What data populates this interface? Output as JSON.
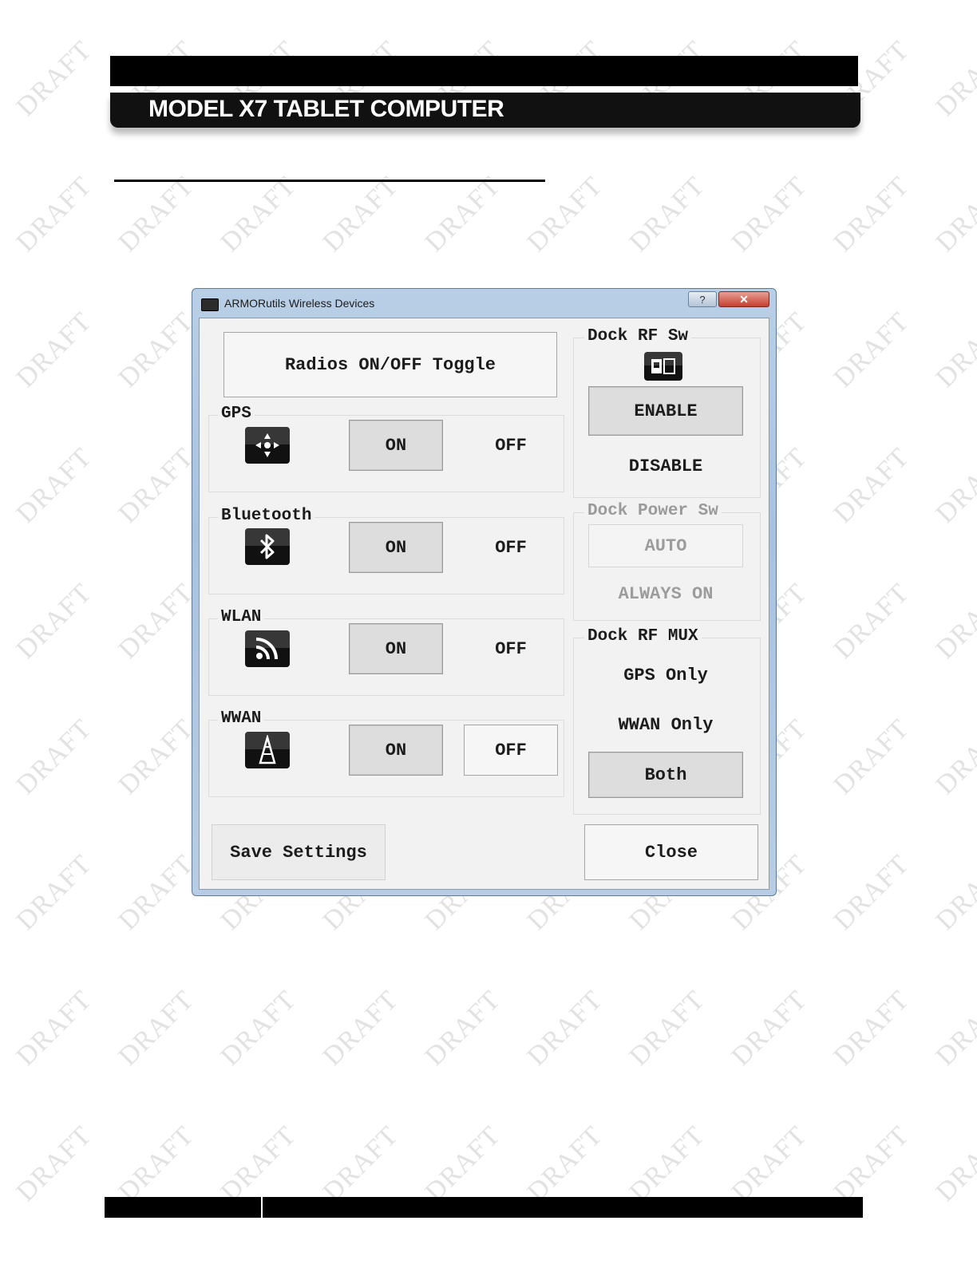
{
  "header": {
    "title": "MODEL X7 TABLET COMPUTER"
  },
  "watermark": "DRAFT",
  "window": {
    "title": "ARMORutils Wireless Devices",
    "help_label": "?",
    "close_label": "✕"
  },
  "radios_toggle_label": "Radios ON/OFF Toggle",
  "devices": [
    {
      "name": "GPS",
      "icon": "gps-crosshair-icon",
      "on_label": "ON",
      "off_label": "OFF",
      "selected": "ON"
    },
    {
      "name": "Bluetooth",
      "icon": "bluetooth-icon",
      "on_label": "ON",
      "off_label": "OFF",
      "selected": "ON"
    },
    {
      "name": "WLAN",
      "icon": "wifi-icon",
      "on_label": "ON",
      "off_label": "OFF",
      "selected": "ON"
    },
    {
      "name": "WWAN",
      "icon": "antenna-tower-icon",
      "on_label": "ON",
      "off_label": "OFF",
      "selected": "ON"
    }
  ],
  "dock_rf_sw": {
    "label": "Dock RF Sw",
    "icon": "dock-switch-icon",
    "enable_label": "ENABLE",
    "disable_label": "DISABLE",
    "selected": "ENABLE"
  },
  "dock_power_sw": {
    "label": "Dock Power Sw",
    "auto_label": "AUTO",
    "always_on_label": "ALWAYS ON",
    "enabled": false
  },
  "dock_rf_mux": {
    "label": "Dock RF MUX",
    "options": [
      "GPS Only",
      "WWAN Only",
      "Both"
    ],
    "selected": "Both"
  },
  "save_label": "Save Settings",
  "close_label": "Close",
  "colors": {
    "window_frame": "#a8c2de",
    "client_bg": "#f2f2f2",
    "pressed_bg": "#dddddd",
    "close_red": "#c63f2d"
  }
}
